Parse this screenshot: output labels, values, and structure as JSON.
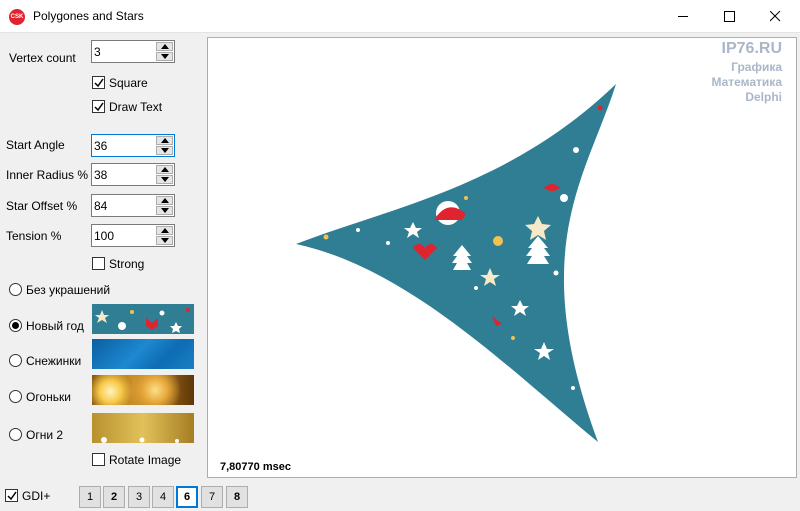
{
  "window": {
    "title": "Polygones and Stars",
    "icon_text": "CSK"
  },
  "controls": {
    "vertex_count": {
      "label": "Vertex count",
      "value": "3"
    },
    "square": {
      "label": "Square",
      "checked": true
    },
    "draw_text": {
      "label": "Draw Text",
      "checked": true
    },
    "start_angle": {
      "label": "Start Angle",
      "value": "36"
    },
    "inner_radius": {
      "label": "Inner Radius %",
      "value": "38"
    },
    "star_offset": {
      "label": "Star Offset %",
      "value": "84"
    },
    "tension": {
      "label": "Tension %",
      "value": "100"
    },
    "strong": {
      "label": "Strong",
      "checked": false
    },
    "rotate_image": {
      "label": "Rotate Image",
      "checked": false
    }
  },
  "textures": [
    {
      "label": "Без украшений",
      "selected": false
    },
    {
      "label": "Новый год",
      "selected": true
    },
    {
      "label": "Снежинки",
      "selected": false
    },
    {
      "label": "Огоньки",
      "selected": false
    },
    {
      "label": "Огни 2",
      "selected": false
    }
  ],
  "watermark": [
    "IP76.RU",
    "Графика",
    "Математика",
    "Delphi"
  ],
  "timing": "7,80770  msec",
  "footer": {
    "gdi": {
      "label": "GDI+",
      "checked": true
    },
    "pages": [
      "1",
      "2",
      "3",
      "4",
      "6",
      "7",
      "8"
    ],
    "active_page": "6"
  },
  "colors": {
    "accent": "#0078d7",
    "star_fill": "#2f7e93",
    "watermark": "#a9b7c9"
  }
}
